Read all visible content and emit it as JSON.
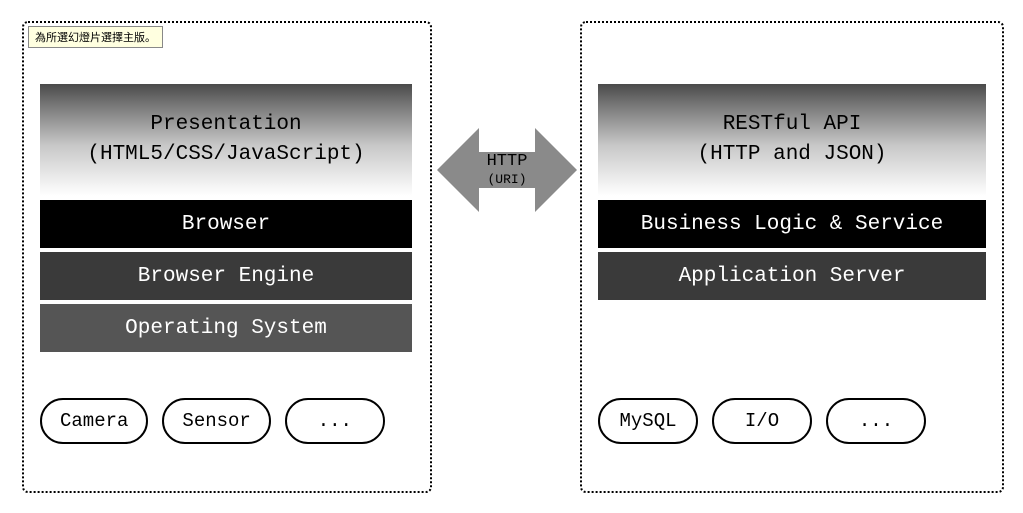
{
  "tooltip": "為所選幻燈片選擇主版。",
  "client": {
    "presentation_title": "Presentation",
    "presentation_sub": "(HTML5/CSS/JavaScript)",
    "layers": [
      "Browser",
      "Browser Engine",
      "Operating System"
    ],
    "devices": [
      "Camera",
      "Sensor",
      "..."
    ]
  },
  "server": {
    "api_title": "RESTful API",
    "api_sub": "(HTTP and JSON)",
    "layers": [
      "Business Logic & Service",
      "Application Server"
    ],
    "resources": [
      "MySQL",
      "I/O",
      "..."
    ]
  },
  "arrow": {
    "protocol": "HTTP",
    "sub": "(URI)"
  }
}
